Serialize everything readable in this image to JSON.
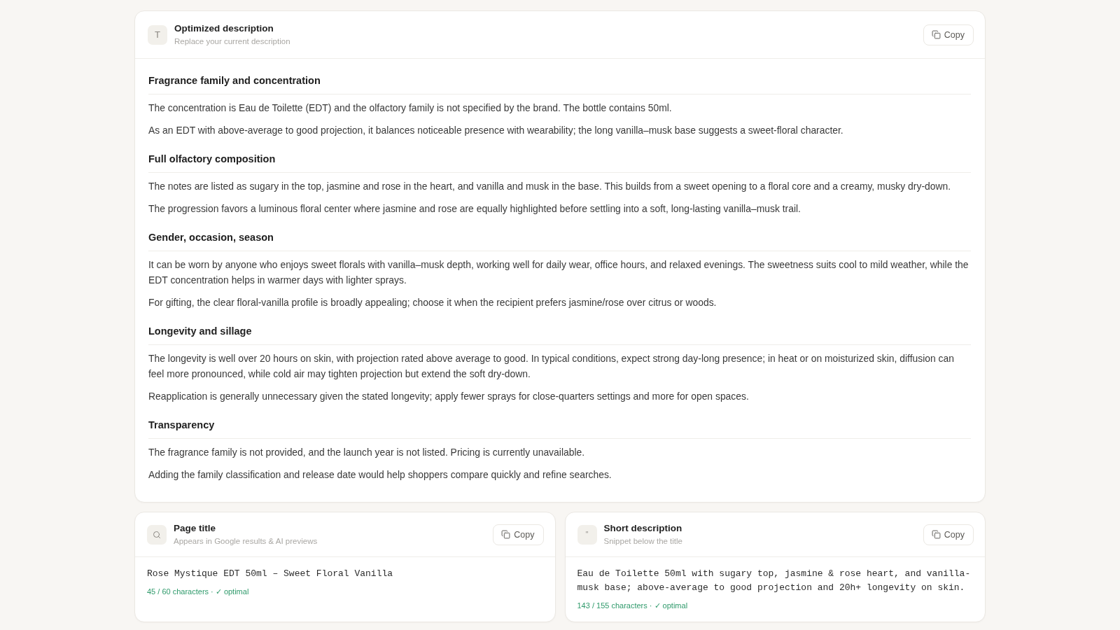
{
  "description_card": {
    "icon": "T",
    "title": "Optimized description",
    "subtitle": "Replace your current description",
    "copy_label": "Copy",
    "sections": [
      {
        "heading": "Fragrance family and concentration",
        "paragraphs": [
          "The concentration is Eau de Toilette (EDT) and the olfactory family is not specified by the brand. The bottle contains 50ml.",
          "As an EDT with above-average to good projection, it balances noticeable presence with wearability; the long vanilla–musk base suggests a sweet-floral character."
        ]
      },
      {
        "heading": "Full olfactory composition",
        "paragraphs": [
          "The notes are listed as sugary in the top, jasmine and rose in the heart, and vanilla and musk in the base. This builds from a sweet opening to a floral core and a creamy, musky dry-down.",
          "The progression favors a luminous floral center where jasmine and rose are equally highlighted before settling into a soft, long-lasting vanilla–musk trail."
        ]
      },
      {
        "heading": "Gender, occasion, season",
        "paragraphs": [
          "It can be worn by anyone who enjoys sweet florals with vanilla–musk depth, working well for daily wear, office hours, and relaxed evenings. The sweetness suits cool to mild weather, while the EDT concentration helps in warmer days with lighter sprays.",
          "For gifting, the clear floral-vanilla profile is broadly appealing; choose it when the recipient prefers jasmine/rose over citrus or woods."
        ]
      },
      {
        "heading": "Longevity and sillage",
        "paragraphs": [
          "The longevity is well over 20 hours on skin, with projection rated above average to good. In typical conditions, expect strong day-long presence; in heat or on moisturized skin, diffusion can feel more pronounced, while cold air may tighten projection but extend the soft dry-down.",
          "Reapplication is generally unnecessary given the stated longevity; apply fewer sprays for close-quarters settings and more for open spaces."
        ]
      },
      {
        "heading": "Transparency",
        "paragraphs": [
          "The fragrance family is not provided, and the launch year is not listed. Pricing is currently unavailable.",
          "Adding the family classification and release date would help shoppers compare quickly and refine searches."
        ]
      }
    ]
  },
  "result_cards": [
    {
      "kind": "search",
      "title": "Page title",
      "subtitle": "Appears in Google results & AI previews",
      "copy_label": "Copy",
      "value": "Rose Mystique EDT 50ml – Sweet Floral Vanilla",
      "counter": "45 / 60 characters · ✓ optimal"
    },
    {
      "kind": "glyph",
      "icon": "\"",
      "title": "Short description",
      "subtitle": "Snippet below the title",
      "copy_label": "Copy",
      "value": "Eau de Toilette 50ml with sugary top, jasmine & rose heart, and vanilla-musk base; above-average to good projection and 20h+ longevity on skin.",
      "counter": "143 / 155 characters · ✓ optimal"
    }
  ]
}
